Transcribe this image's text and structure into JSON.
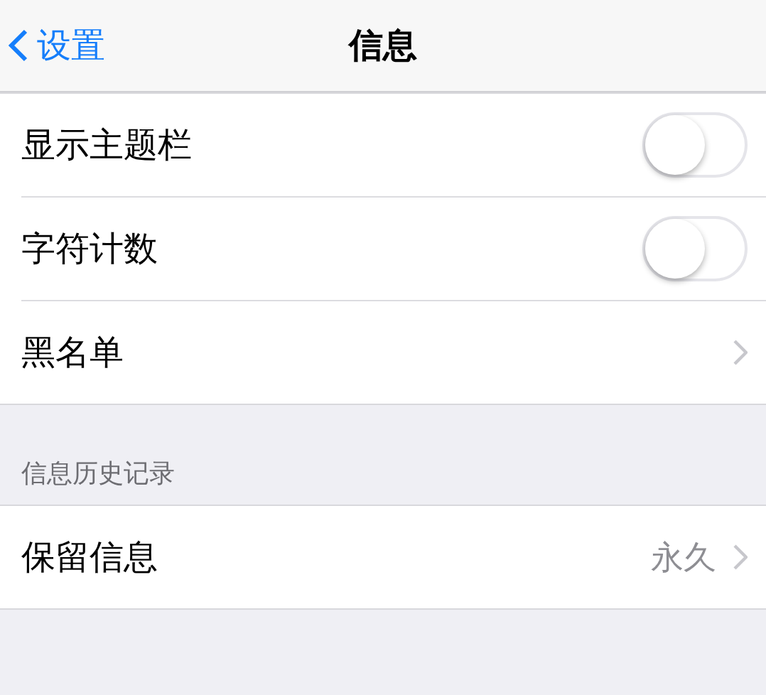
{
  "nav": {
    "back": "设置",
    "title": "信息"
  },
  "groups": [
    {
      "rows": [
        {
          "kind": "toggle",
          "label": "显示主题栏",
          "on": false
        },
        {
          "kind": "toggle",
          "label": "字符计数",
          "on": false
        },
        {
          "kind": "link",
          "label": "黑名单"
        }
      ]
    },
    {
      "header": "信息历史记录",
      "rows": [
        {
          "kind": "link",
          "label": "保留信息",
          "value": "永久"
        }
      ]
    }
  ]
}
